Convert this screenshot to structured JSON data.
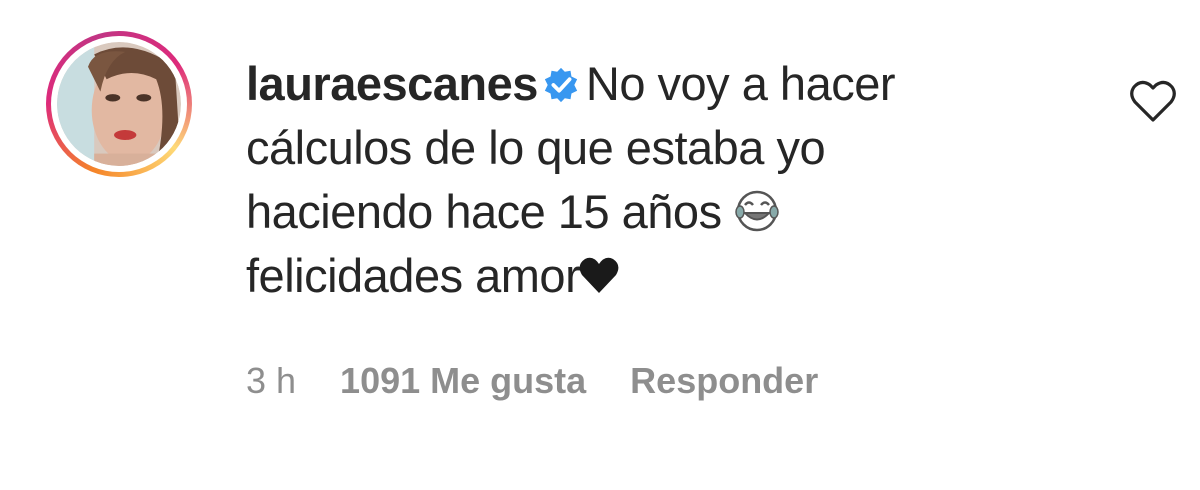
{
  "comment": {
    "username": "lauraescanes",
    "verified_icon": "verified-badge-icon",
    "text_before_emoji": "No voy a hacer cálculos de lo que estaba yo haciendo hace 15 años",
    "emoji_1": "face-with-tears-of-joy-icon",
    "text_after_emoji": "felicidades amor",
    "emoji_2": "black-heart-icon",
    "time": "3 h",
    "likes": "1091 Me gusta",
    "reply_label": "Responder",
    "like_icon": "heart-outline-icon"
  },
  "colors": {
    "text": "#262626",
    "meta": "#8e8e8e",
    "verified": "#3897f0"
  }
}
